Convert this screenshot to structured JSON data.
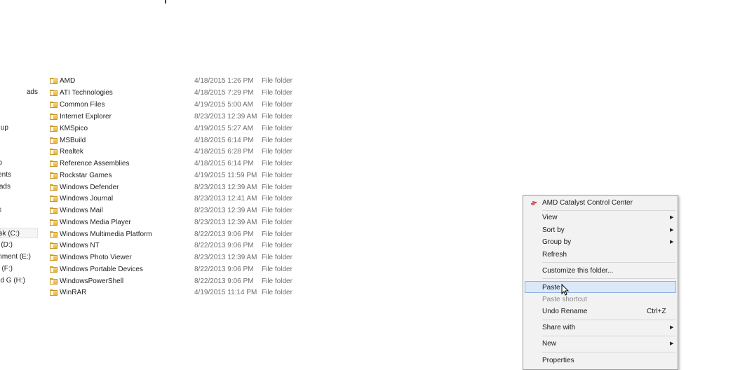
{
  "nav_items": [
    {
      "label": "ads",
      "selected": false
    },
    {
      "label": "up",
      "selected": false
    },
    {
      "label": "o",
      "selected": false
    },
    {
      "label": "ents",
      "selected": false
    },
    {
      "label": "ads",
      "selected": false
    },
    {
      "label": "s",
      "selected": false
    },
    {
      "label": "isk (C:)",
      "selected": true
    },
    {
      "label": "(D:)",
      "selected": false
    },
    {
      "label": "nment (E:)",
      "selected": false
    },
    {
      "label": "s (F:)",
      "selected": false
    },
    {
      "label": "d G (H:)",
      "selected": false
    }
  ],
  "files": [
    {
      "name": "AMD",
      "date": "4/18/2015 1:26 PM",
      "type": "File folder"
    },
    {
      "name": "ATI Technologies",
      "date": "4/18/2015 7:29 PM",
      "type": "File folder"
    },
    {
      "name": "Common Files",
      "date": "4/19/2015 5:00 AM",
      "type": "File folder"
    },
    {
      "name": "Internet Explorer",
      "date": "8/23/2013 12:39 AM",
      "type": "File folder"
    },
    {
      "name": "KMSpico",
      "date": "4/19/2015 5:27 AM",
      "type": "File folder"
    },
    {
      "name": "MSBuild",
      "date": "4/18/2015 6:14 PM",
      "type": "File folder"
    },
    {
      "name": "Realtek",
      "date": "4/18/2015 6:28 PM",
      "type": "File folder"
    },
    {
      "name": "Reference Assemblies",
      "date": "4/18/2015 6:14 PM",
      "type": "File folder"
    },
    {
      "name": "Rockstar Games",
      "date": "4/19/2015 11:59 PM",
      "type": "File folder"
    },
    {
      "name": "Windows Defender",
      "date": "8/23/2013 12:39 AM",
      "type": "File folder"
    },
    {
      "name": "Windows Journal",
      "date": "8/23/2013 12:41 AM",
      "type": "File folder"
    },
    {
      "name": "Windows Mail",
      "date": "8/23/2013 12:39 AM",
      "type": "File folder"
    },
    {
      "name": "Windows Media Player",
      "date": "8/23/2013 12:39 AM",
      "type": "File folder"
    },
    {
      "name": "Windows Multimedia Platform",
      "date": "8/22/2013 9:06 PM",
      "type": "File folder"
    },
    {
      "name": "Windows NT",
      "date": "8/22/2013 9:06 PM",
      "type": "File folder"
    },
    {
      "name": "Windows Photo Viewer",
      "date": "8/23/2013 12:39 AM",
      "type": "File folder"
    },
    {
      "name": "Windows Portable Devices",
      "date": "8/22/2013 9:06 PM",
      "type": "File folder"
    },
    {
      "name": "WindowsPowerShell",
      "date": "8/22/2013 9:06 PM",
      "type": "File folder"
    },
    {
      "name": "WinRAR",
      "date": "4/19/2015 11:14 PM",
      "type": "File folder"
    }
  ],
  "context_menu": {
    "amd": "AMD Catalyst Control Center",
    "view": "View",
    "sort_by": "Sort by",
    "group_by": "Group by",
    "refresh": "Refresh",
    "customize": "Customize this folder...",
    "paste": "Paste",
    "paste_shortcut": "Paste shortcut",
    "undo_rename": "Undo Rename",
    "undo_shortcut": "Ctrl+Z",
    "share_with": "Share with",
    "new": "New",
    "properties": "Properties",
    "submenu_arrow": "▶"
  },
  "icons": {
    "folder": "folder-icon",
    "amd": "amd-catalyst-icon",
    "cursor": "mouse-pointer-icon"
  },
  "colors": {
    "highlight": "#dbe8f8",
    "highlight_border": "#8fb2e0",
    "menu_bg": "#f2f2f2",
    "folder": "#f0c350"
  }
}
